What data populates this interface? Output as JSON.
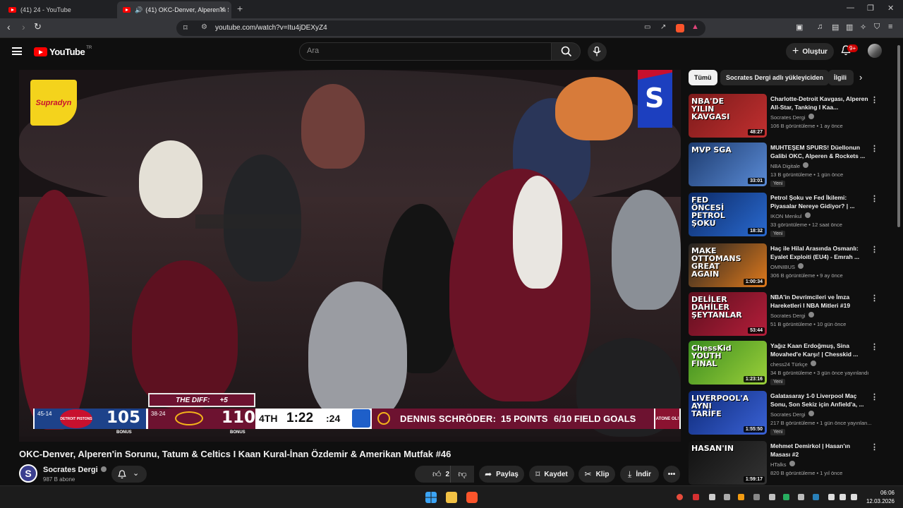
{
  "browser": {
    "tabs": [
      {
        "label": "(41) 24 - YouTube",
        "active": false
      },
      {
        "label": "(41) OKC-Denver, Alperen'in S",
        "active": true
      }
    ],
    "url": "youtube.com/watch?v=Itu4jDEXyZ4"
  },
  "youtube": {
    "logo_text": "YouTube",
    "country_code": "TR",
    "search_placeholder": "Ara",
    "create_label": "Oluştur",
    "notification_count": "9+"
  },
  "video": {
    "title": "OKC-Denver, Alperen'in Sorunu, Tatum & Celtics I Kaan Kural-İnan Özdemir & Amerikan Mutfak #46",
    "channel": "Socrates Dergi",
    "subscribers": "987 B abone",
    "likes": "2 B",
    "share_label": "Paylaş",
    "save_label": "Kaydet",
    "clip_label": "Klip",
    "download_label": "İndir",
    "sponsor_logo": "Supradyn",
    "channel_watermark": "S",
    "scoreboard": {
      "diff_label": "THE DIFF:",
      "diff_value": "+5",
      "home_record": "45-14",
      "home_team": "DETROIT PISTONS",
      "home_score": "105",
      "away_record": "38-24",
      "away_score": "110",
      "bonus_label": "BONUS",
      "period": "4TH",
      "clock": "1:22",
      "shot_clock": ":24",
      "stat_player": "DENNIS SCHRÖDER:",
      "stat_points": "15 POINTS",
      "stat_fg": "6/10 FIELD GOALS",
      "corner_tag": "ATONE OL!"
    }
  },
  "sidebar": {
    "chips": [
      "Tümü",
      "Socrates Dergi adlı yükleyiciden",
      "İlgili"
    ],
    "items": [
      {
        "title": "Charlotte-Detroit Kavgası, Alperen All-Star, Tanking I Kaa...",
        "channel": "Socrates Dergi",
        "meta": "106 B görüntüleme • 1 ay önce",
        "duration": "48:27",
        "thumb_text": "NBA'DE YILIN KAVGASI",
        "badge": "",
        "colors": [
          "#7a1a1a",
          "#c23030"
        ]
      },
      {
        "title": "MUHTEŞEM SPURS! Düellonun Galibi OKC, Alperen & Rockets ...",
        "channel": "NBA Digitale",
        "meta": "13 B görüntüleme • 1 gün önce",
        "duration": "33:01",
        "thumb_text": "MVP SGA",
        "badge": "Yeni",
        "colors": [
          "#1d3b6e",
          "#5a8bd6"
        ]
      },
      {
        "title": "Petrol Şoku ve Fed İkilemi: Piyasalar Nereye Gidiyor? | ...",
        "channel": "IKON Menkul",
        "meta": "33 görüntüleme • 12 saat önce",
        "duration": "18:32",
        "thumb_text": "FED ÖNCESİ PETROL ŞOKU",
        "badge": "Yeni",
        "colors": [
          "#0c2a66",
          "#2a6ad0"
        ]
      },
      {
        "title": "Haç ile Hilal Arasında Osmanlı: Eyalet Exploiti (EU4) - Emrah ...",
        "channel": "OMNIBUS",
        "meta": "306 B görüntüleme • 9 ay önce",
        "duration": "1:00:34",
        "thumb_text": "MAKE OTTOMANS GREAT AGAIN",
        "badge": "",
        "colors": [
          "#222222",
          "#e07a1c"
        ]
      },
      {
        "title": "NBA'in Devrimcileri ve İmza Hareketleri I NBA Mitleri #19",
        "channel": "Socrates Dergi",
        "meta": "51 B görüntüleme • 10 gün önce",
        "duration": "53:44",
        "thumb_text": "DELİLER DAHİLER ŞEYTANLAR",
        "badge": "",
        "colors": [
          "#5c0f1e",
          "#b51e3a"
        ]
      },
      {
        "title": "Yağız Kaan Erdoğmuş, Sina Movahed'e Karşı! | Chesskid ...",
        "channel": "chess24 Türkçe",
        "meta": "34 B görüntüleme • 3 gün önce yayınlandı",
        "duration": "1:23:16",
        "thumb_text": "ChessKid YOUTH FINAL",
        "badge": "Yeni",
        "colors": [
          "#3b8c1f",
          "#9bd03a"
        ]
      },
      {
        "title": "Galatasaray 1-0 Liverpool Maç Sonu, Son Sekiz için Anfield'a, ...",
        "channel": "Socrates Dergi",
        "meta": "217 B görüntüleme • 1 gün önce yayınlan...",
        "duration": "1:55:50",
        "thumb_text": "LIVERPOOL'A AYNI TARİFE",
        "badge": "Yeni",
        "colors": [
          "#0e2a78",
          "#3a62d6"
        ]
      },
      {
        "title": "Mehmet Demirkol | Hasan'ın Masası #2",
        "channel": "HTalks",
        "meta": "820 B görüntüleme • 1 yıl önce",
        "duration": "1:59:17",
        "thumb_text": "HASAN'IN",
        "badge": "",
        "colors": [
          "#111111",
          "#333333"
        ]
      }
    ]
  },
  "taskbar": {
    "time": "06:06",
    "date": "12.03.2026"
  }
}
